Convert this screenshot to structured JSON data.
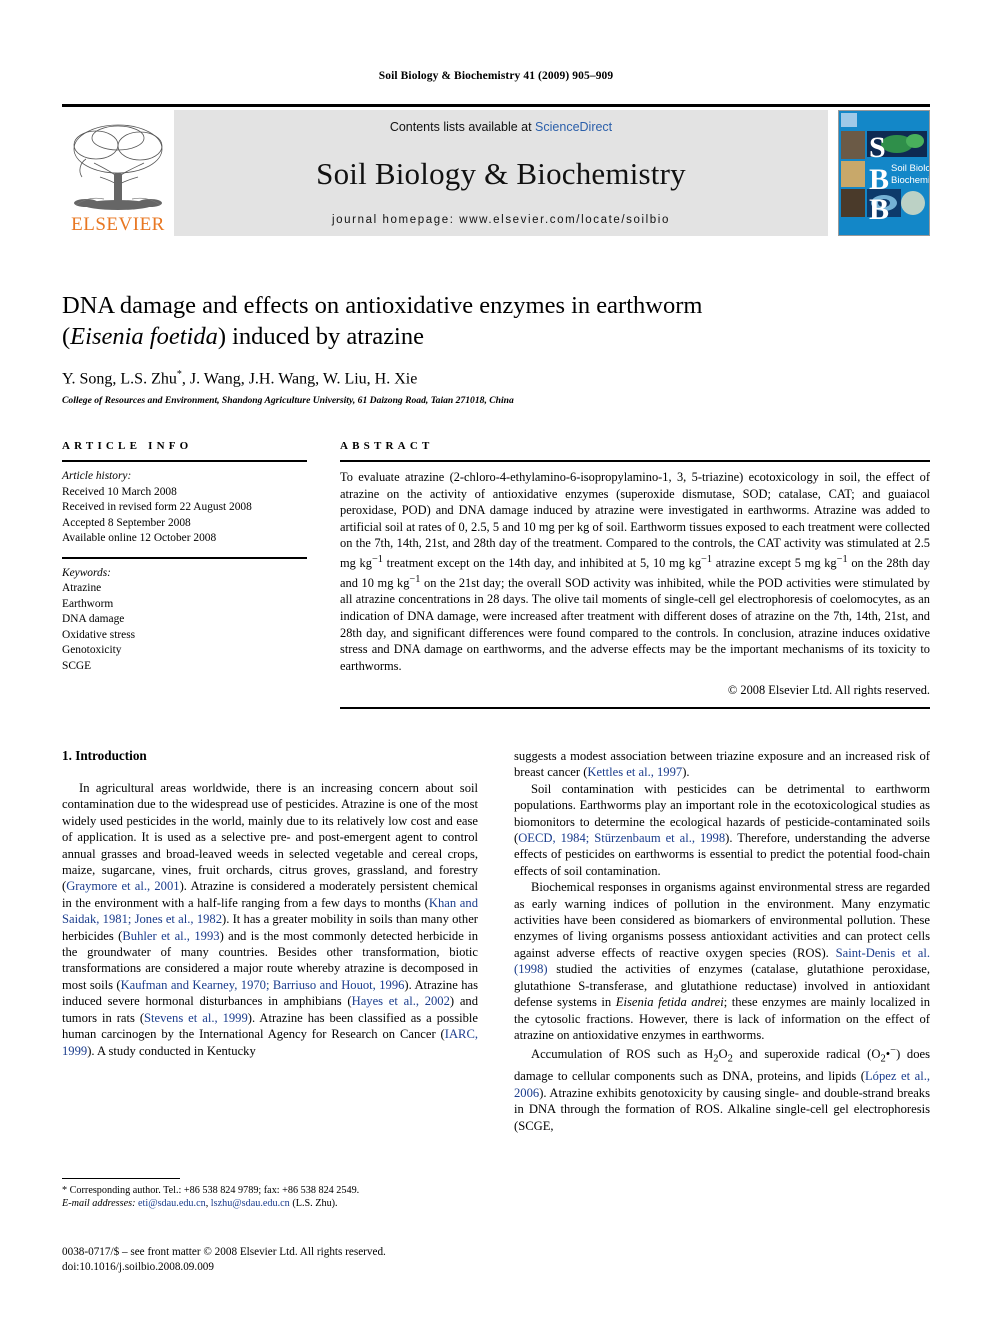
{
  "running_head": "Soil Biology & Biochemistry 41 (2009) 905–909",
  "masthead": {
    "publisher_name": "ELSEVIER",
    "contents_prefix": "Contents lists available at ",
    "contents_link": "ScienceDirect",
    "journal_title": "Soil Biology & Biochemistry",
    "homepage": "journal homepage: www.elsevier.com/locate/soilbio",
    "cover": {
      "letters": [
        "S",
        "B",
        "B"
      ],
      "cover_title_line1": "Soil Biology &",
      "cover_title_line2": "Biochemistry",
      "bg_color": "#1387c8"
    }
  },
  "article": {
    "title_line1": "DNA damage and effects on antioxidative enzymes in earthworm",
    "title_italic": "Eisenia foetida",
    "title_line2_pre": "(",
    "title_line2_post": ") induced by atrazine",
    "authors": "Y. Song, L.S. Zhu",
    "authors_star": "*",
    "authors_rest": ", J. Wang, J.H. Wang, W. Liu, H. Xie",
    "affiliation": "College of Resources and Environment, Shandong Agriculture University, 61 Daizong Road, Taian 271018, China"
  },
  "article_info": {
    "heading": "ARTICLE INFO",
    "history_label": "Article history:",
    "history": [
      "Received 10 March 2008",
      "Received in revised form 22 August 2008",
      "Accepted 8 September 2008",
      "Available online 12 October 2008"
    ],
    "keywords_label": "Keywords:",
    "keywords": [
      "Atrazine",
      "Earthworm",
      "DNA damage",
      "Oxidative stress",
      "Genotoxicity",
      "SCGE"
    ]
  },
  "abstract": {
    "heading": "ABSTRACT",
    "text_part1": "To evaluate atrazine (2-chloro-4-ethylamino-6-isopropylamino-1, 3, 5-triazine) ecotoxicology in soil, the effect of atrazine on the activity of antioxidative enzymes (superoxide dismutase, SOD; catalase, CAT; and guaiacol peroxidase, POD) and DNA damage induced by atrazine were investigated in earthworms. Atrazine was added to artificial soil at rates of 0, 2.5, 5 and 10 mg per kg of soil. Earthworm tissues exposed to each treatment were collected on the 7th, 14th, 21st, and 28th day of the treatment. Compared to the controls, the CAT activity was stimulated at 2.5 mg kg",
    "sup1": "−1",
    "text_part2": " treatment except on the 14th day, and inhibited at 5, 10 mg kg",
    "sup2": "−1",
    "text_part3": " atrazine except 5 mg kg",
    "sup3": "−1",
    "text_part4": " on the 28th day and 10 mg kg",
    "sup4": "−1",
    "text_part5": " on the 21st day; the overall SOD activity was inhibited, while the POD activities were stimulated by all atrazine concentrations in 28 days. The olive tail moments of single-cell gel electrophoresis of coelomocytes, as an indication of DNA damage, were increased after treatment with different doses of atrazine on the 7th, 14th, 21st, and 28th day, and significant differences were found compared to the controls. In conclusion, atrazine induces oxidative stress and DNA damage on earthworms, and the adverse effects may be the important mechanisms of its toxicity to earthworms.",
    "copyright": "© 2008 Elsevier Ltd. All rights reserved."
  },
  "introduction": {
    "heading": "1. Introduction",
    "left_paragraph_1_a": "In agricultural areas worldwide, there is an increasing concern about soil contamination due to the widespread use of pesticides. Atrazine is one of the most widely used pesticides in the world, mainly due to its relatively low cost and ease of application. It is used as a selective pre- and post-emergent agent to control annual grasses and broad-leaved weeds in selected vegetable and cereal crops, maize, sugarcane, vines, fruit orchards, citrus groves, grassland, and forestry (",
    "ref_graymore": "Graymore et al., 2001",
    "left_paragraph_1_b": "). Atrazine is considered a moderately persistent chemical in the environment with a half-life ranging from a few days to months (",
    "ref_khan": "Khan and Saidak, 1981; Jones et al., 1982",
    "left_paragraph_1_c": "). It has a greater mobility in soils than many other herbicides (",
    "ref_buhler": "Buhler et al., 1993",
    "left_paragraph_1_d": ") and is the most commonly detected herbicide in the groundwater of many countries. Besides other transformation, biotic transformations are considered a major route whereby atrazine is decomposed in most soils (",
    "ref_kaufman": "Kaufman and Kearney, 1970; Barriuso and Houot, 1996",
    "left_paragraph_1_e": "). Atrazine has induced severe hormonal disturbances in amphibians (",
    "ref_hayes": "Hayes et al., 2002",
    "left_paragraph_1_f": ") and tumors in rats (",
    "ref_stevens": "Stevens et al., 1999",
    "left_paragraph_1_g": "). Atrazine has been classified as a possible human carcinogen by the International Agency for Research on Cancer (",
    "ref_iarc": "IARC, 1999",
    "left_paragraph_1_h": "). A study conducted in Kentucky",
    "right_paragraph_1_a": "suggests a modest association between triazine exposure and an increased risk of breast cancer (",
    "ref_kettles": "Kettles et al., 1997",
    "right_paragraph_1_b": ").",
    "right_paragraph_2_a": "Soil contamination with pesticides can be detrimental to earthworm populations. Earthworms play an important role in the ecotoxicological studies as biomonitors to determine the ecological hazards of pesticide-contaminated soils (",
    "ref_oecd": "OECD, 1984; Stürzenbaum et al., 1998",
    "right_paragraph_2_b": "). Therefore, understanding the adverse effects of pesticides on earthworms is essential to predict the potential food-chain effects of soil contamination.",
    "right_paragraph_3_a": "Biochemical responses in organisms against environmental stress are regarded as early warning indices of pollution in the environment. Many enzymatic activities have been considered as biomarkers of environmental pollution. These enzymes of living organisms possess antioxidant activities and can protect cells against adverse effects of reactive oxygen species (ROS). ",
    "ref_saintdenis": "Saint-Denis et al. (1998)",
    "right_paragraph_3_b": " studied the activities of enzymes (catalase, glutathione peroxidase, glutathione S-transferase, and glutathione reductase) involved in antioxidant defense systems in ",
    "italic_species": "Eisenia fetida andrei",
    "right_paragraph_3_c": "; these enzymes are mainly localized in the cytosolic fractions. However, there is lack of information on the effect of atrazine on antioxidative enzymes in earthworms.",
    "right_paragraph_4_a": "Accumulation of ROS such as H",
    "sub_2a": "2",
    "right_paragraph_4_b": "O",
    "sub_2b": "2",
    "right_paragraph_4_c": " and superoxide radical (O",
    "sub_2c": "2",
    "right_paragraph_4_d": "•",
    "sup_minus": "−",
    "right_paragraph_4_e": ") does damage to cellular components such as DNA, proteins, and lipids (",
    "ref_lopez": "López et al., 2006",
    "right_paragraph_4_f": "). Atrazine exhibits genotoxicity by causing single- and double-strand breaks in DNA through the formation of ROS. Alkaline single-cell gel electrophoresis (SCGE,"
  },
  "footnote": {
    "star": "*",
    "corresponding": " Corresponding author. Tel.: +86 538 824 9789; fax: +86 538 824 2549.",
    "email_label": "E-mail addresses:",
    "email1": "eti@sdau.edu.cn",
    "email_sep": ", ",
    "email2": "lszhu@sdau.edu.cn",
    "email_suffix": " (L.S. Zhu)."
  },
  "imprint": {
    "line1": "0038-0717/$ – see front matter © 2008 Elsevier Ltd. All rights reserved.",
    "line2": "doi:10.1016/j.soilbio.2008.09.009"
  }
}
